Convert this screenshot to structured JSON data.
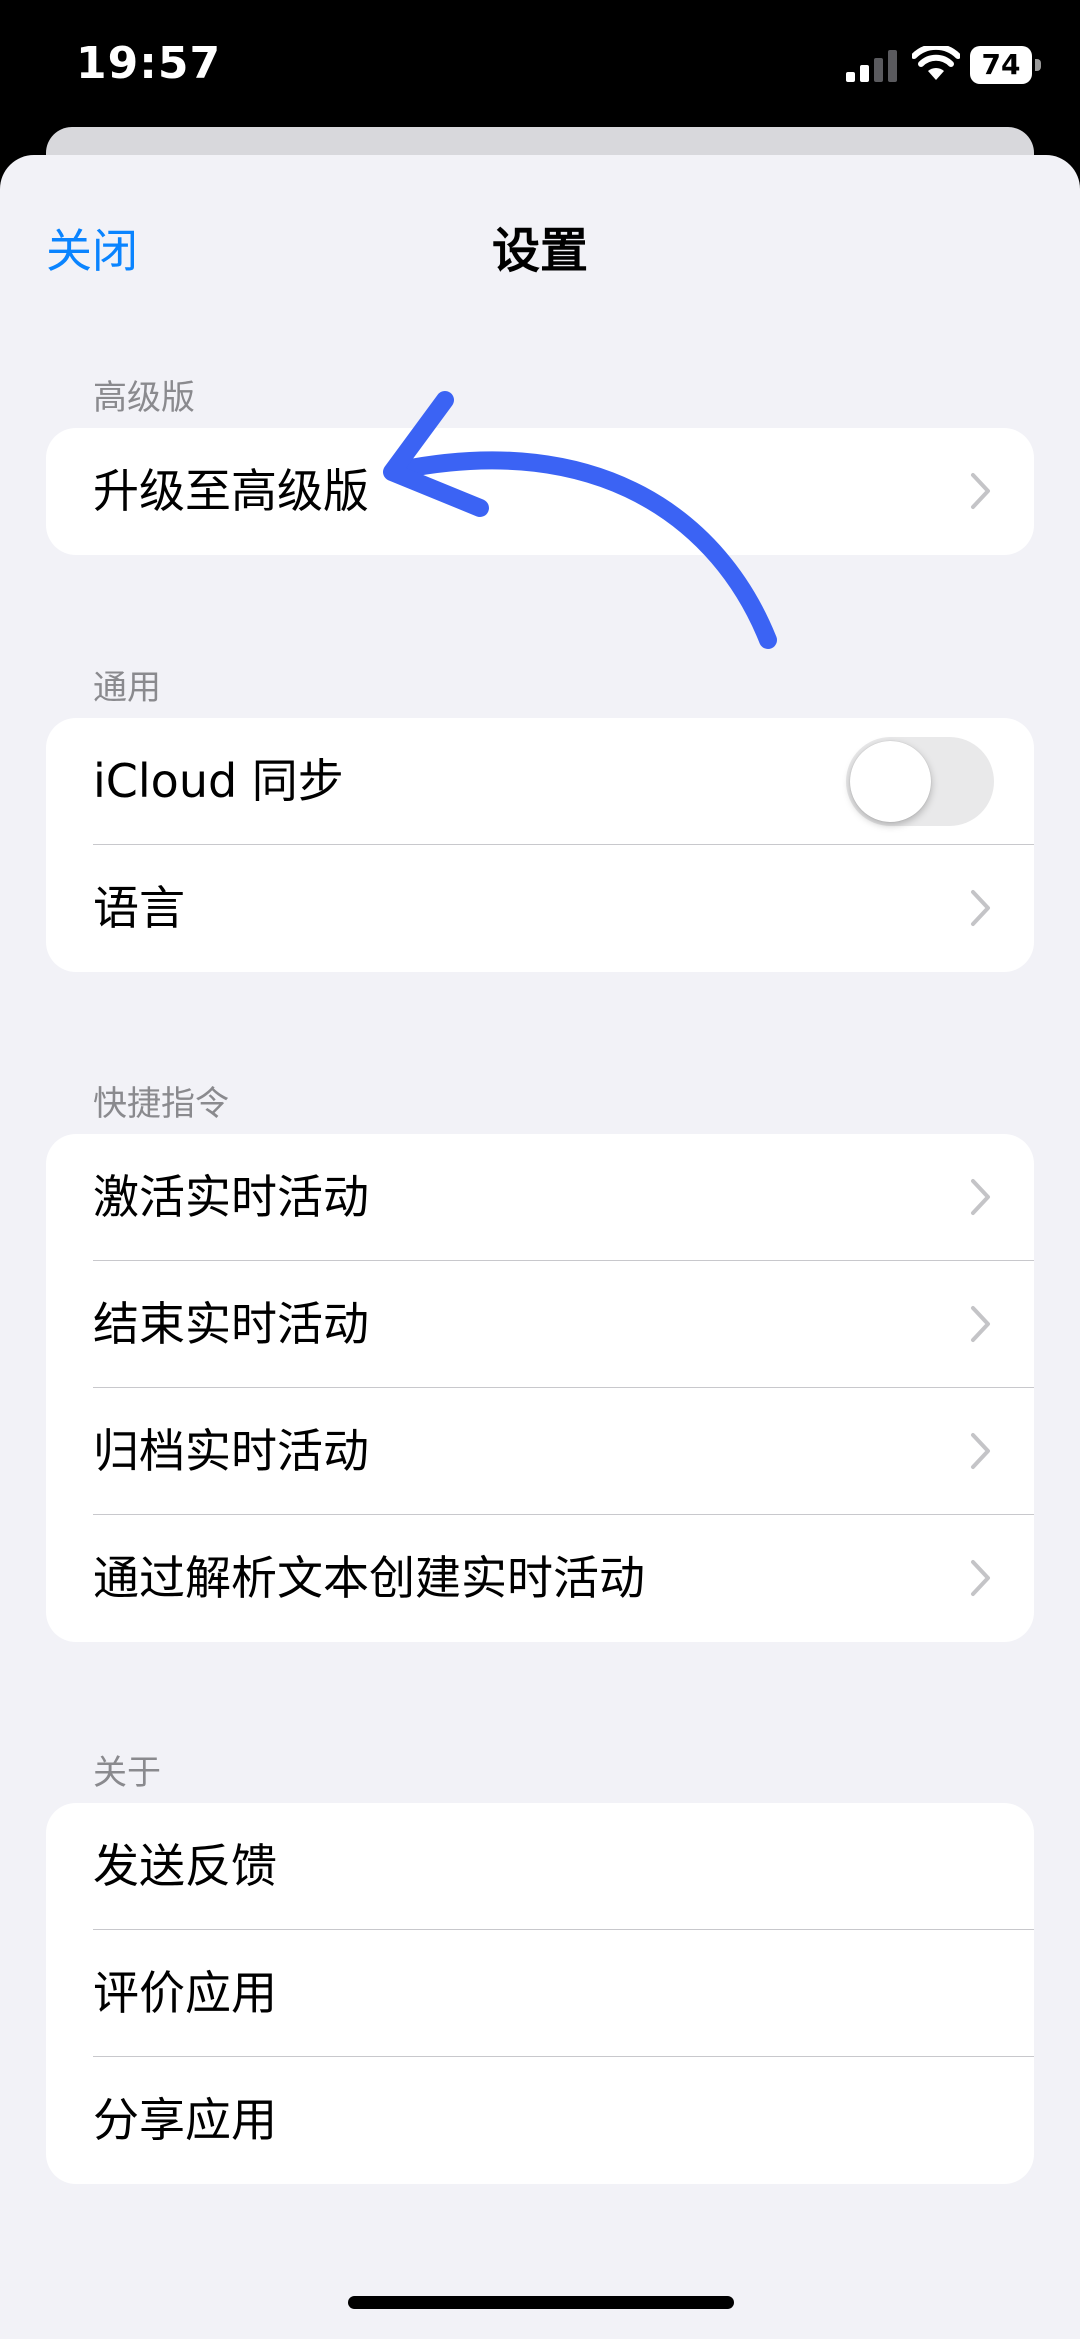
{
  "status_bar": {
    "time": "19:57",
    "battery": "74",
    "icons": [
      "signal-icon",
      "wifi-icon",
      "battery-icon"
    ]
  },
  "nav": {
    "close": "关闭",
    "title": "设置"
  },
  "sections": {
    "premium": {
      "header": "高级版",
      "items": [
        {
          "label": "升级至高级版",
          "accessory": "chevron-right-icon"
        }
      ]
    },
    "general": {
      "header": "通用",
      "items": [
        {
          "label": "iCloud 同步",
          "accessory": "toggle",
          "toggle_on": false
        },
        {
          "label": "语言",
          "accessory": "chevron-right-icon"
        }
      ]
    },
    "shortcuts": {
      "header": "快捷指令",
      "items": [
        {
          "label": "激活实时活动",
          "accessory": "chevron-right-icon"
        },
        {
          "label": "结束实时活动",
          "accessory": "chevron-right-icon"
        },
        {
          "label": "归档实时活动",
          "accessory": "chevron-right-icon"
        },
        {
          "label": "通过解析文本创建实时活动",
          "accessory": "chevron-right-icon"
        }
      ]
    },
    "about": {
      "header": "关于",
      "items": [
        {
          "label": "发送反馈"
        },
        {
          "label": "评价应用"
        },
        {
          "label": "分享应用"
        }
      ]
    }
  },
  "colors": {
    "accent": "#0a84ff",
    "annotation_arrow": "#3b63f4",
    "background": "#f2f2f7"
  }
}
